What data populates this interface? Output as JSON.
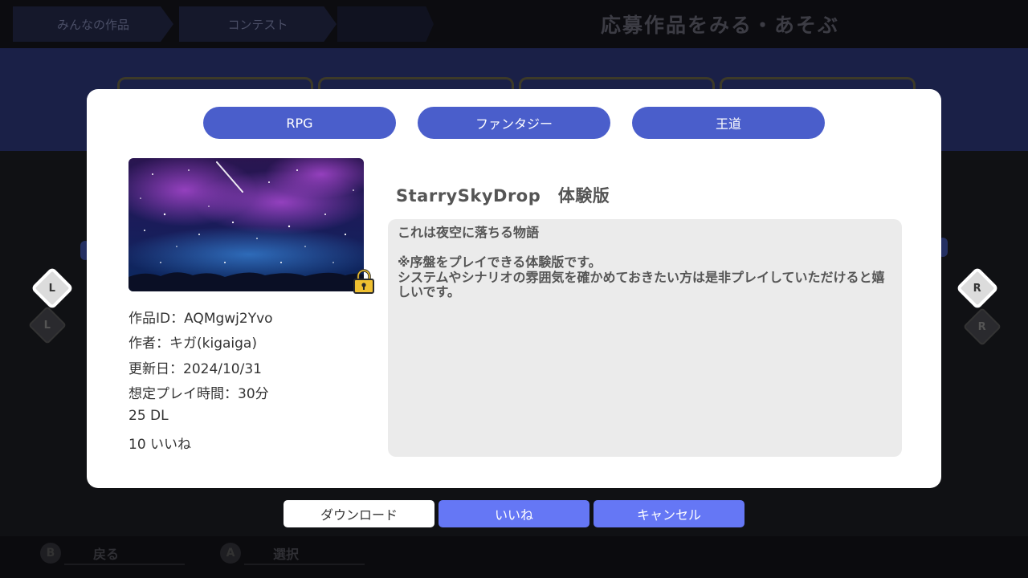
{
  "background": {
    "breadcrumbs": [
      "みんなの作品",
      "コンテスト"
    ],
    "header_title": "応募作品をみる・あそぶ",
    "hints": [
      {
        "key": "B",
        "label": "戻る"
      },
      {
        "key": "A",
        "label": "選択"
      }
    ]
  },
  "nav": {
    "left_key": "L",
    "right_key": "R"
  },
  "modal": {
    "tags": [
      "RPG",
      "ファンタジー",
      "王道"
    ],
    "title": "StarrySkyDrop　体験版",
    "info": {
      "id": "作品ID：AQMgwj2Yvo",
      "author": "作者：キガ(kigaiga)",
      "updated": "更新日：2024/10/31",
      "playtime": "想定プレイ時間：30分",
      "downloads": "25 DL",
      "likes": "10 いいね"
    },
    "description": "これは夜空に落ちる物語\n\n※序盤をプレイできる体験版です。\nシステムやシナリオの雰囲気を確かめておきたい方は是非プレイしていただけると嬉しいです。"
  },
  "buttons": {
    "download": "ダウンロード",
    "like": "いいね",
    "cancel": "キャンセル"
  },
  "colors": {
    "tag_bg": "#4a5ecb",
    "button_blue": "#6577f5",
    "modal_bg": "#ffffff",
    "desc_bg": "#ebebeb"
  }
}
